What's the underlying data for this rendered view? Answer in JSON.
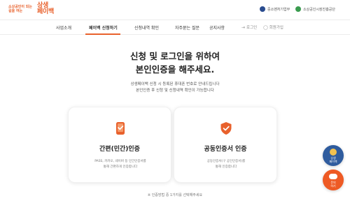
{
  "header": {
    "logo_small_text": "소상공인이 되는 길을 여는",
    "logo_big_line1": "상생",
    "logo_big_line2": "페이백",
    "gov_links": [
      {
        "label": "중소벤처기업부",
        "color": "#2a4c8f"
      },
      {
        "label": "소상공인시장진흥공단",
        "color": "#3a9b4f"
      }
    ]
  },
  "nav": {
    "items": [
      {
        "label": "사업소개",
        "active": false
      },
      {
        "label": "페이백 신청하기",
        "active": true
      },
      {
        "label": "신청내역 확인",
        "active": false
      },
      {
        "label": "자주묻는 질문",
        "active": false
      },
      {
        "label": "공지사항",
        "active": false
      }
    ],
    "links": [
      {
        "label": "로그인",
        "icon": "login-icon"
      },
      {
        "label": "회원가입",
        "icon": "user-icon"
      }
    ]
  },
  "main": {
    "title_line1": "신청 및 로그인을 위하여",
    "title_line2": "본인인증을 해주세요.",
    "subtitle_line1": "상생페이백 신청 시 등록된 휴대폰 번호로 안내드립니다",
    "subtitle_line2": "본인인증 후 신청 및 신청내역 확인이 가능합니다",
    "cards": [
      {
        "title": "간편(민간)인증",
        "desc_line1": "PASS, 카카오, 네이버 등 민간인증서를",
        "desc_line2": "통해 간편하게 인증합니다",
        "icon": "phone-check-icon"
      },
      {
        "title": "공동인증서 인증",
        "desc_line1": "공동인증서(구 공인인증서)를",
        "desc_line2": "통해 인증합니다",
        "icon": "shield-check-icon"
      }
    ],
    "footer_note": "※ 인증방법 중 1가지를 선택해주세요"
  },
  "floating": {
    "chatbot_label_1": "상생",
    "chatbot_label_2": "페이백",
    "help_label_1": "문의",
    "help_label_2": "하기"
  },
  "colors": {
    "accent": "#e8612c",
    "fab_blue": "#2f5c9e",
    "fab_orange": "#ee5a24"
  }
}
